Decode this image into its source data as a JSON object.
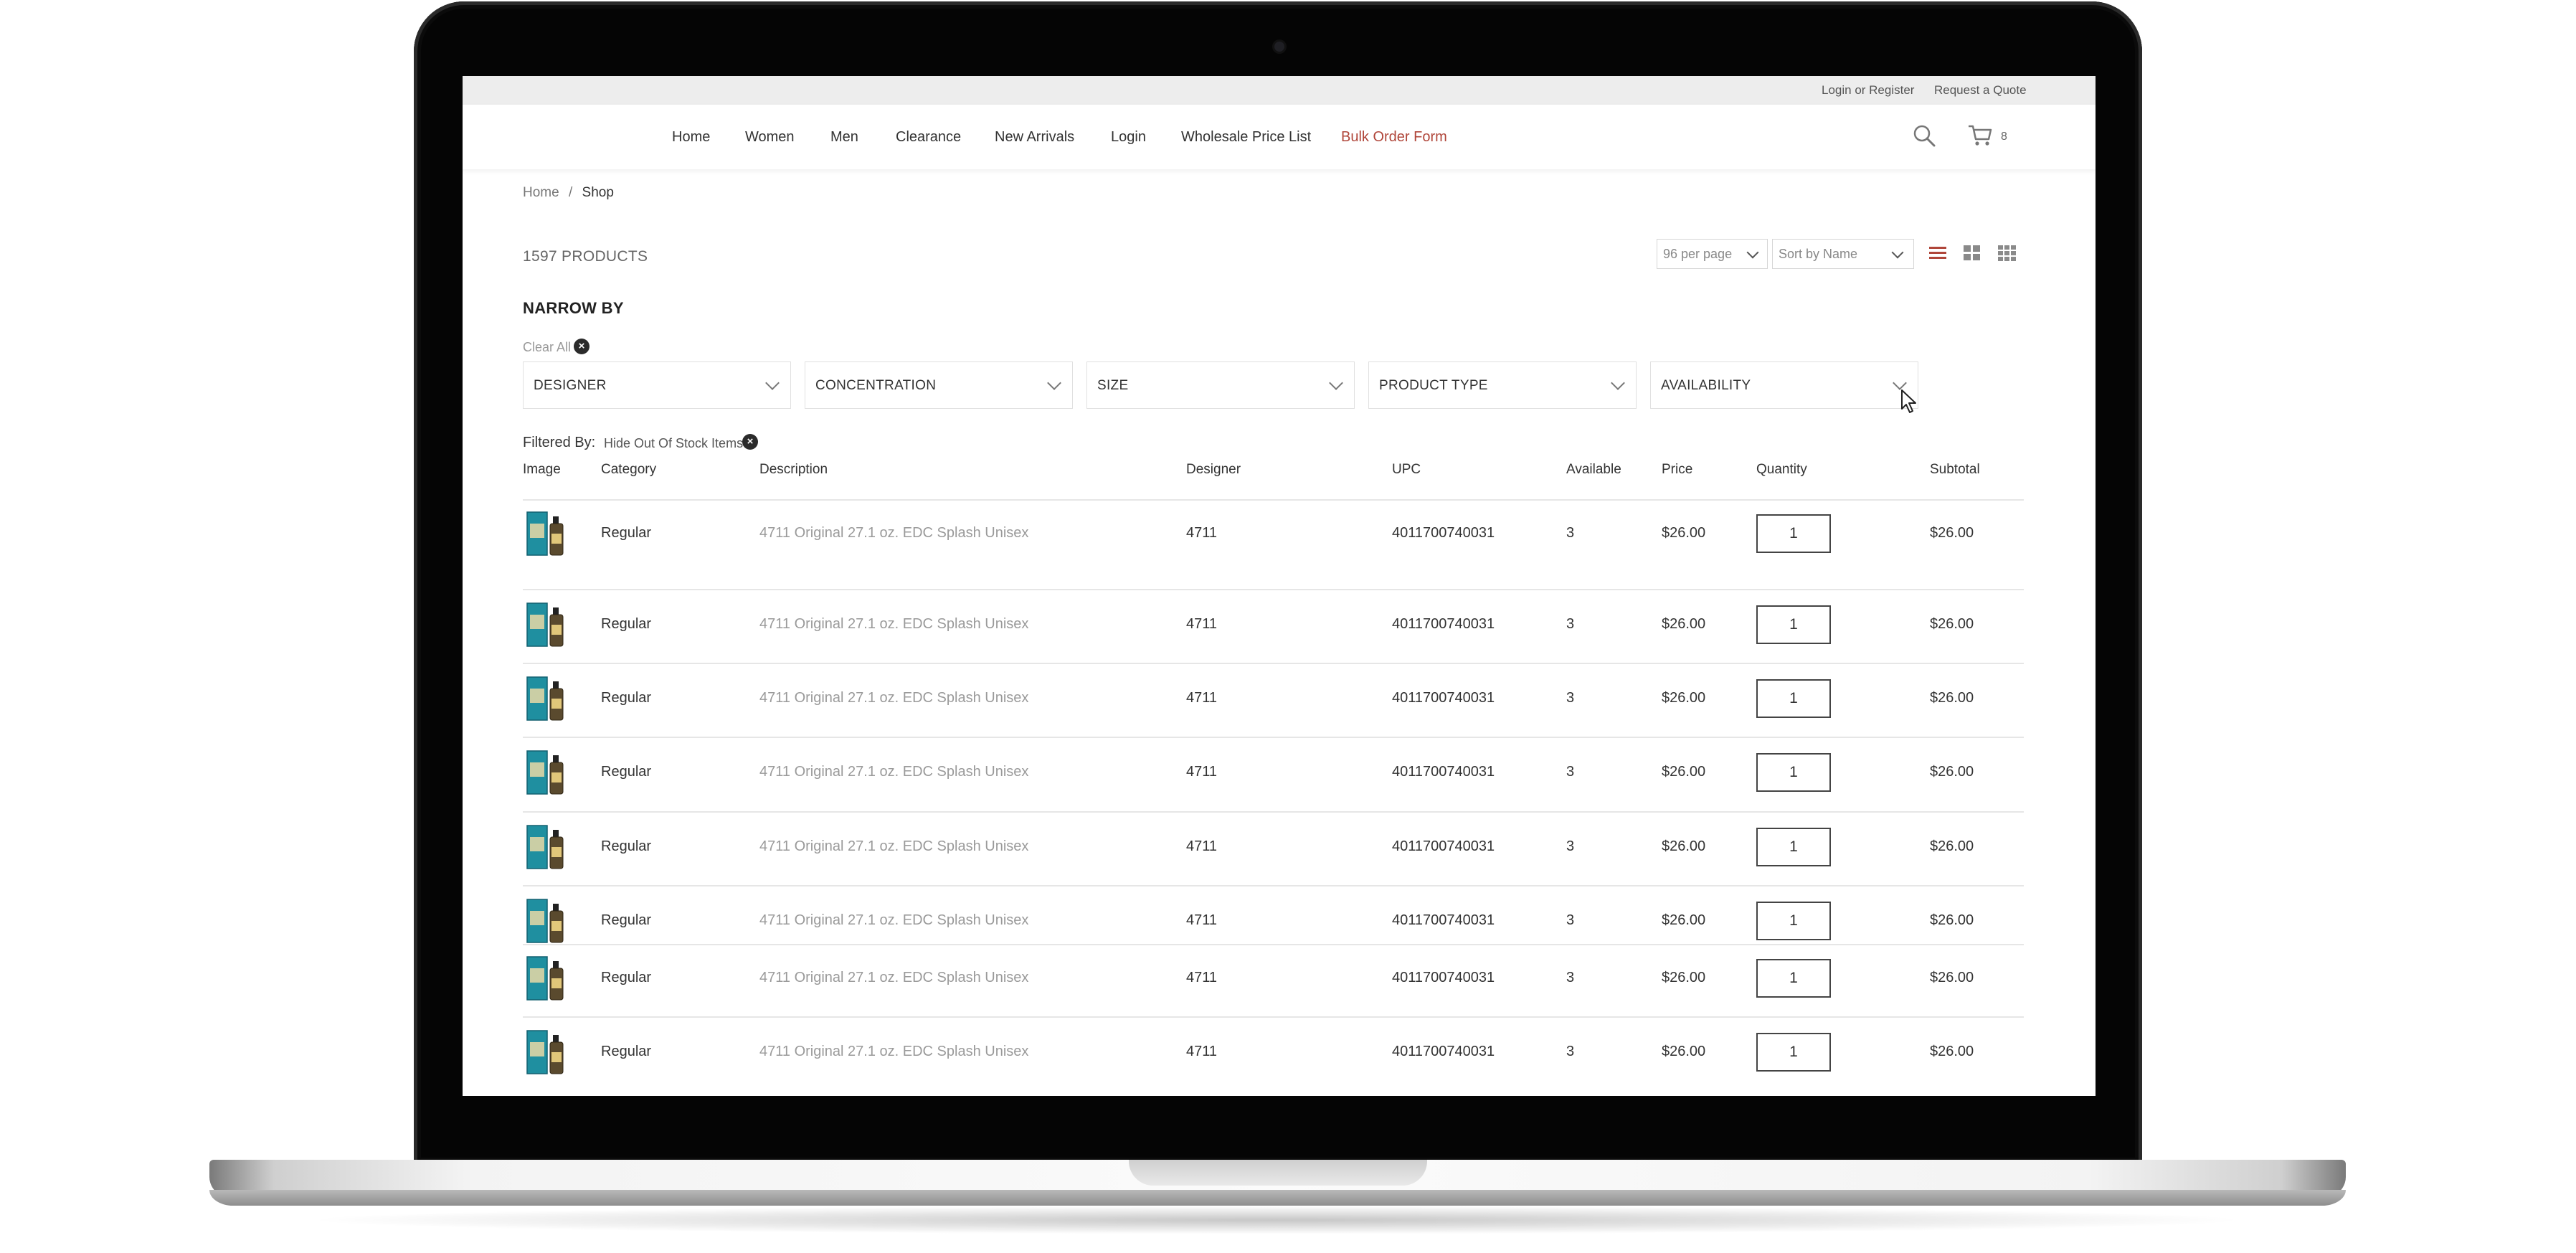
{
  "topbar": {
    "login": "Login or Register",
    "quote": "Request a Quote"
  },
  "nav": {
    "items": [
      "Home",
      "Women",
      "Men",
      "Clearance",
      "New Arrivals",
      "Login",
      "Wholesale Price List"
    ],
    "bulk_order": "Bulk Order Form",
    "cart_count": "8"
  },
  "breadcrumb": {
    "home": "Home",
    "separator": "/",
    "current": "Shop"
  },
  "toolbar": {
    "product_count": "1597 PRODUCTS",
    "per_page": "96 per page",
    "sort": "Sort by Name"
  },
  "filters": {
    "heading": "NARROW BY",
    "clear_all": "Clear All",
    "facets": [
      "DESIGNER",
      "CONCENTRATION",
      "SIZE",
      "PRODUCT TYPE",
      "AVAILABILITY"
    ],
    "filtered_by_label": "Filtered By:",
    "active_filter": "Hide Out Of Stock Items"
  },
  "table": {
    "columns": [
      "Image",
      "Category",
      "Description",
      "Designer",
      "UPC",
      "Available",
      "Price",
      "Quantity",
      "Subtotal"
    ],
    "rows": [
      {
        "category": "Regular",
        "description": "4711 Original 27.1 oz. EDC Splash Unisex",
        "designer": "4711",
        "upc": "4011700740031",
        "available": "3",
        "price": "$26.00",
        "quantity": "1",
        "subtotal": "$26.00"
      },
      {
        "category": "Regular",
        "description": "4711 Original 27.1 oz. EDC Splash Unisex",
        "designer": "4711",
        "upc": "4011700740031",
        "available": "3",
        "price": "$26.00",
        "quantity": "1",
        "subtotal": "$26.00"
      },
      {
        "category": "Regular",
        "description": "4711 Original 27.1 oz. EDC Splash Unisex",
        "designer": "4711",
        "upc": "4011700740031",
        "available": "3",
        "price": "$26.00",
        "quantity": "1",
        "subtotal": "$26.00"
      },
      {
        "category": "Regular",
        "description": "4711 Original 27.1 oz. EDC Splash Unisex",
        "designer": "4711",
        "upc": "4011700740031",
        "available": "3",
        "price": "$26.00",
        "quantity": "1",
        "subtotal": "$26.00"
      },
      {
        "category": "Regular",
        "description": "4711 Original 27.1 oz. EDC Splash Unisex",
        "designer": "4711",
        "upc": "4011700740031",
        "available": "3",
        "price": "$26.00",
        "quantity": "1",
        "subtotal": "$26.00"
      },
      {
        "category": "Regular",
        "description": "4711 Original 27.1 oz. EDC Splash Unisex",
        "designer": "4711",
        "upc": "4011700740031",
        "available": "3",
        "price": "$26.00",
        "quantity": "1",
        "subtotal": "$26.00"
      },
      {
        "category": "Regular",
        "description": "4711 Original 27.1 oz. EDC Splash Unisex",
        "designer": "4711",
        "upc": "4011700740031",
        "available": "3",
        "price": "$26.00",
        "quantity": "1",
        "subtotal": "$26.00"
      },
      {
        "category": "Regular",
        "description": "4711 Original 27.1 oz. EDC Splash Unisex",
        "designer": "4711",
        "upc": "4011700740031",
        "available": "3",
        "price": "$26.00",
        "quantity": "1",
        "subtotal": "$26.00"
      }
    ]
  },
  "icons": {
    "search": "search-icon",
    "cart": "cart-icon",
    "list_view": "list-view-icon",
    "grid_view": "grid-view-icon",
    "small_grid_view": "small-grid-view-icon",
    "close": "close-icon",
    "chevron": "chevron-down-icon",
    "cursor": "mouse-cursor-icon"
  },
  "colors": {
    "accent": "#b0463a",
    "product_box": "#1f8fa0",
    "product_bottle": "#5a4a2e"
  }
}
